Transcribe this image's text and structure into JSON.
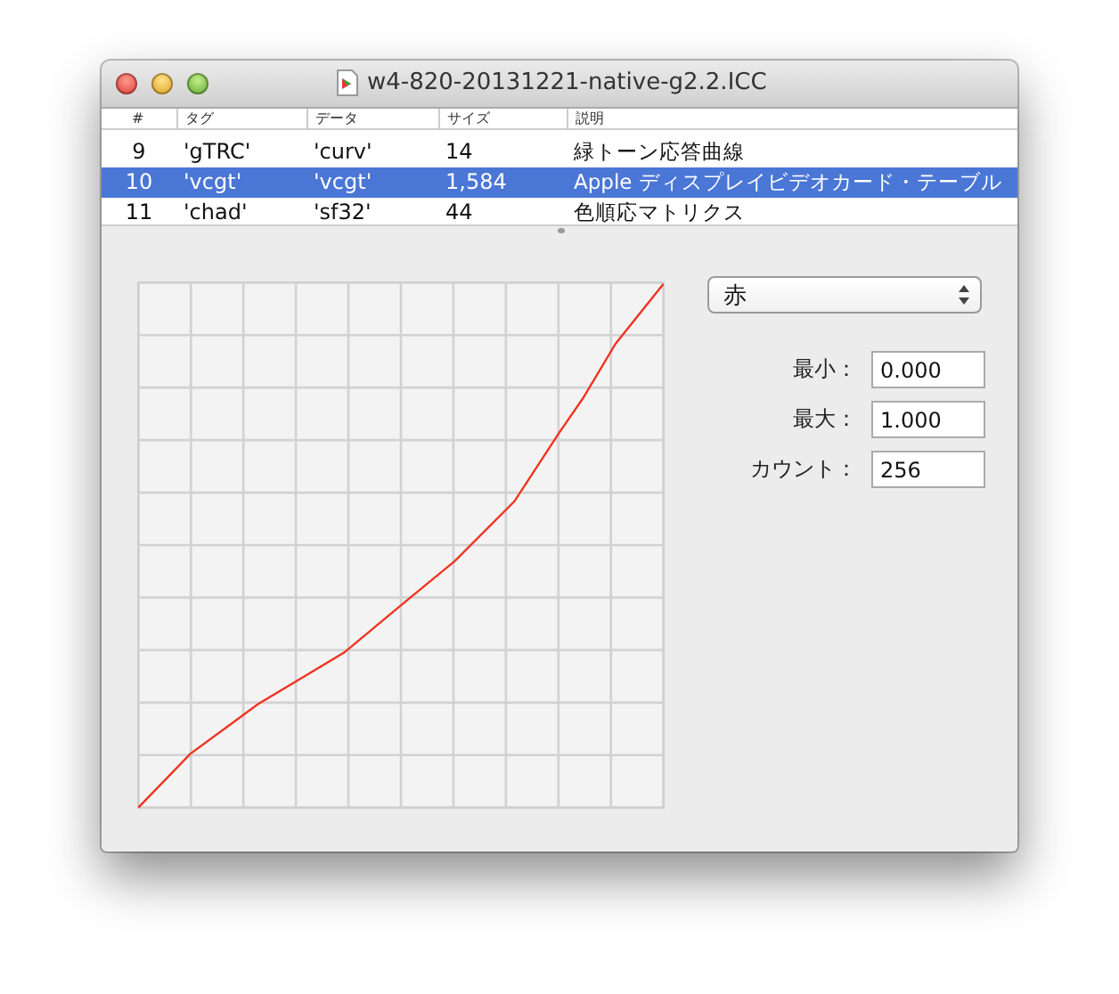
{
  "window": {
    "title": "w4-820-20131221-native-g2.2.ICC"
  },
  "table": {
    "columns": [
      "#",
      "タグ",
      "データ",
      "サイズ",
      "説明"
    ],
    "rows": [
      {
        "cells": [
          "9",
          "'gTRC'",
          "'curv'",
          "14",
          "緑トーン応答曲線"
        ],
        "selected": false
      },
      {
        "cells": [
          "10",
          "'vcgt'",
          "'vcgt'",
          "1,584",
          "Apple ディスプレイビデオカード・テーブル"
        ],
        "selected": true
      },
      {
        "cells": [
          "11",
          "'chad'",
          "'sf32'",
          "44",
          "色順応マトリクス"
        ],
        "selected": false
      }
    ]
  },
  "channel_popup": {
    "value": "赤"
  },
  "fields": [
    {
      "label": "最小：",
      "value": "0.000"
    },
    {
      "label": "最大：",
      "value": "1.000"
    },
    {
      "label": "カウント：",
      "value": "256"
    }
  ]
}
